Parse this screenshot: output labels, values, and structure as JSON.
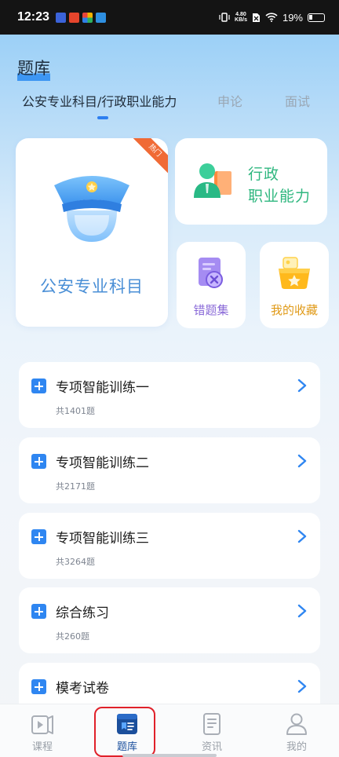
{
  "status_bar": {
    "time": "12:23",
    "net_speed_value": "4.80",
    "net_speed_unit": "KB/s",
    "battery": "19%"
  },
  "header": {
    "title": "题库"
  },
  "tabs": [
    {
      "label": "公安专业科目/行政职业能力",
      "active": true
    },
    {
      "label": "申论",
      "active": false
    },
    {
      "label": "面试",
      "active": false
    }
  ],
  "cards": {
    "police": {
      "label": "公安专业科目",
      "badge": "热门"
    },
    "admin": {
      "label_line1": "行政",
      "label_line2": "职业能力"
    },
    "wrong": {
      "label": "错题集"
    },
    "favorites": {
      "label": "我的收藏"
    }
  },
  "list": [
    {
      "title": "专项智能训练一",
      "count": "共1401题"
    },
    {
      "title": "专项智能训练二",
      "count": "共2171题"
    },
    {
      "title": "专项智能训练三",
      "count": "共3264题"
    },
    {
      "title": "综合练习",
      "count": "共260题"
    },
    {
      "title": "模考试卷",
      "count": ""
    }
  ],
  "bottom_nav": [
    {
      "label": "课程",
      "icon": "play-book-icon",
      "active": false
    },
    {
      "label": "题库",
      "icon": "question-bank-icon",
      "active": true
    },
    {
      "label": "资讯",
      "icon": "document-icon",
      "active": false
    },
    {
      "label": "我的",
      "icon": "user-icon",
      "active": false
    }
  ],
  "colors": {
    "accent": "#2f86f1",
    "active_nav": "#1a4f9d",
    "highlight": "#e0212a"
  }
}
